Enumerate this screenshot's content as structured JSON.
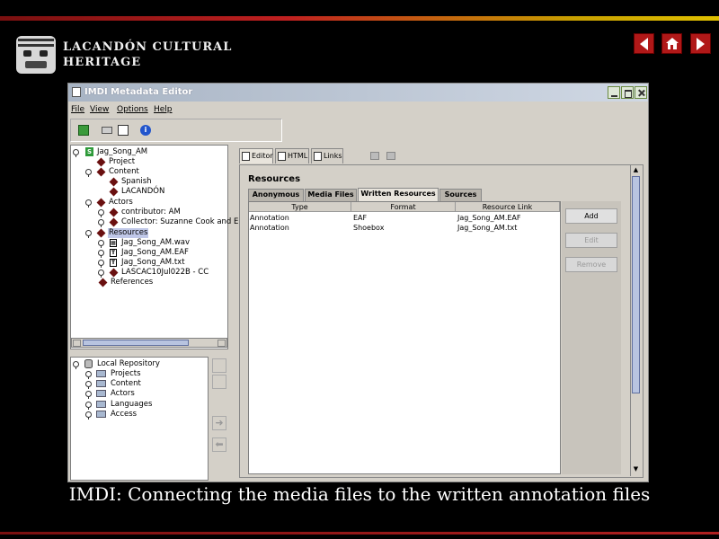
{
  "slide": {
    "site_title_line1": "Lacandón Cultural",
    "site_title_line2": "Heritage",
    "caption": "IMDI: Connecting the media files to the written annotation files",
    "nav": [
      "back-arrow-icon",
      "home-icon",
      "forward-arrow-icon"
    ],
    "accent_color": "#b01818"
  },
  "window": {
    "title": "IMDI Metadata Editor",
    "menus": [
      "File",
      "View",
      "Options",
      "Help"
    ],
    "toolbar_icons": [
      "new-document-icon",
      "open-icon",
      "save-icon",
      "info-icon"
    ]
  },
  "tree": {
    "root": "Jag_Song_AM",
    "items": [
      {
        "label": "Project"
      },
      {
        "label": "Content"
      },
      {
        "label": "Spanish"
      },
      {
        "label": "LACANDÓN"
      },
      {
        "label": "Actors"
      },
      {
        "label": "contributor: AM"
      },
      {
        "label": "Collector: Suzanne Cook and E"
      },
      {
        "label": "Resources"
      },
      {
        "label": "Jag_Song_AM.wav"
      },
      {
        "label": "Jag_Song_AM.EAF"
      },
      {
        "label": "Jag_Song_AM.txt"
      },
      {
        "label": "LASCAC10Jul022B - CC"
      },
      {
        "label": "References"
      }
    ]
  },
  "repository": {
    "root": "Local Repository",
    "items": [
      "Projects",
      "Content",
      "Actors",
      "Languages",
      "Access"
    ]
  },
  "editor": {
    "tabs": [
      "Editor",
      "HTML",
      "Links"
    ],
    "section_title": "Resources",
    "inner_tabs": [
      "Anonymous",
      "Media Files",
      "Written Resources",
      "Sources"
    ],
    "active_inner_tab": "Written Resources",
    "columns": [
      "Type",
      "Format",
      "Resource Link"
    ],
    "rows": [
      [
        "Annotation",
        "EAF",
        "Jag_Song_AM.EAF"
      ],
      [
        "Annotation",
        "Shoebox",
        "Jag_Song_AM.txt"
      ]
    ],
    "buttons": {
      "add": "Add",
      "edit": "Edit",
      "remove": "Remove"
    }
  }
}
